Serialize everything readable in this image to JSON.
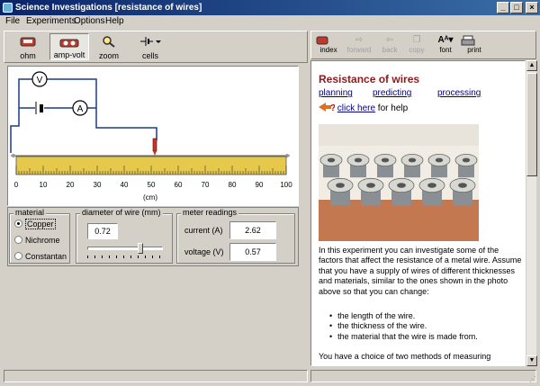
{
  "window": {
    "title": "Science Investigations [resistance of wires]",
    "controls": {
      "minimize": "_",
      "maximize": "□",
      "close": "×"
    }
  },
  "menu": [
    "File",
    "Experiments",
    "Options",
    "Help"
  ],
  "left_toolbar": {
    "tools": [
      {
        "label": "ohm",
        "icon": "ohmmeter-icon"
      },
      {
        "label": "amp-volt",
        "icon": "ammeter-voltmeter-icon",
        "active": true
      },
      {
        "label": "zoom",
        "icon": "magnifier-icon"
      },
      {
        "label": "cells",
        "icon": "battery-cells-icon"
      }
    ]
  },
  "circuit": {
    "voltmeter_label": "V",
    "ammeter_label": "A",
    "ruler": {
      "ticks": [
        "0",
        "10",
        "20",
        "30",
        "40",
        "50",
        "60",
        "70",
        "80",
        "90",
        "100"
      ],
      "unit": "(cm)",
      "probe_position_cm": 50,
      "colors": {
        "ruler": "#e6c84a",
        "wire": "#1a3c8c",
        "probe": "#c0392b"
      }
    }
  },
  "material": {
    "title": "material",
    "options": [
      "Copper",
      "Nichrome",
      "Constantan"
    ],
    "selected": "Copper"
  },
  "diameter": {
    "title": "diameter of wire (mm)",
    "value": "0.72",
    "slider_fraction": 0.72
  },
  "meter": {
    "title": "meter readings",
    "current_label": "current (A)",
    "current_value": "2.62",
    "voltage_label": "voltage (V)",
    "voltage_value": "0.57"
  },
  "doc_toolbar": {
    "buttons": [
      {
        "label": "index",
        "icon": "index-icon",
        "enabled": true
      },
      {
        "label": "forward",
        "icon": "forward-arrow-icon",
        "enabled": false
      },
      {
        "label": "back",
        "icon": "back-arrow-icon",
        "enabled": false
      },
      {
        "label": "copy",
        "icon": "copy-icon",
        "enabled": false
      },
      {
        "label": "font",
        "icon": "font-icon",
        "enabled": true
      },
      {
        "label": "print",
        "icon": "printer-icon",
        "enabled": true
      }
    ]
  },
  "document": {
    "heading": "Resistance of wires",
    "links": [
      "planning",
      "predicting",
      "processing"
    ],
    "help_link": "click here",
    "help_suffix": " for help",
    "para1": "In this experiment you can investigate some of the factors that affect the resistance of a metal wire. Assume that you have a supply of wires of different thicknesses and materials, similar to the ones shown in the photo above so that you can change:",
    "bullets": [
      "the length of the wire.",
      "the thickness of the wire.",
      "the material that the wire is made from."
    ],
    "para2": "You have a choice of two methods of measuring"
  },
  "colors": {
    "title_gradient_start": "#0a246a",
    "title_gradient_end": "#3a6ea5",
    "heading": "#8b1a1a",
    "link": "#00008b"
  }
}
